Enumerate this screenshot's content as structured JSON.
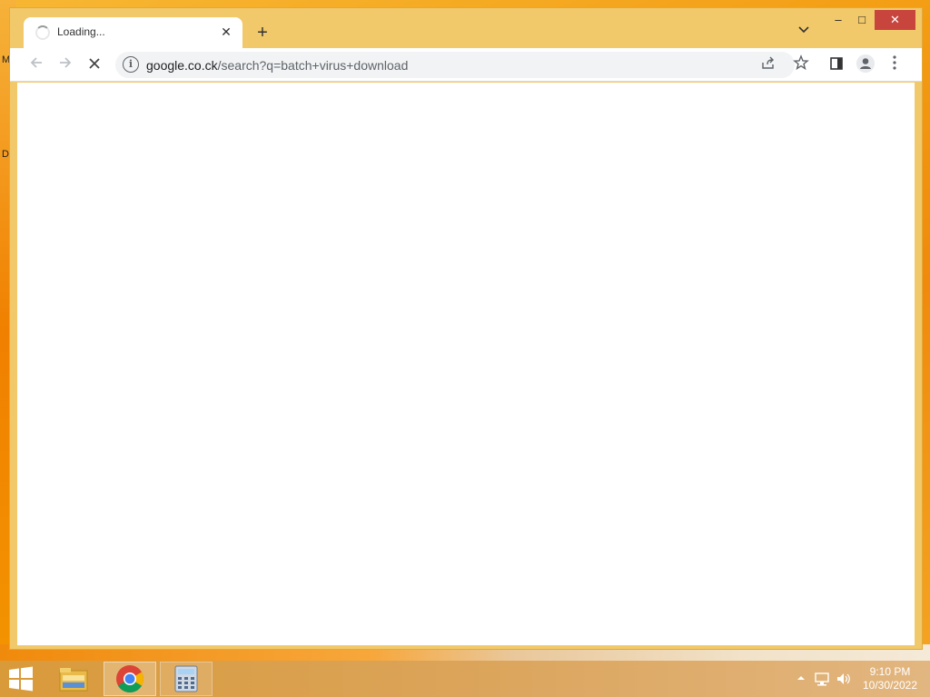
{
  "desktop": {
    "icon_label_1": "M",
    "icon_label_2": "D"
  },
  "browser": {
    "tab": {
      "title": "Loading...",
      "state": "loading"
    },
    "window_controls": {
      "minimize": "–",
      "maximize": "□",
      "close": "✕"
    },
    "toolbar": {
      "back_icon": "arrow-left-icon",
      "forward_icon": "arrow-right-icon",
      "stop_icon": "stop-x-icon"
    },
    "omnibox": {
      "host": "google.co.ck",
      "path": "/search?q=batch+virus+download"
    }
  },
  "taskbar": {
    "apps": [
      "File Explorer",
      "Google Chrome",
      "Calculator"
    ],
    "clock": {
      "time": "9:10 PM",
      "date": "10/30/2022"
    }
  },
  "colors": {
    "window_frame": "#f1c86a",
    "close_button": "#c7453d",
    "taskbar": "#d99a3a"
  }
}
